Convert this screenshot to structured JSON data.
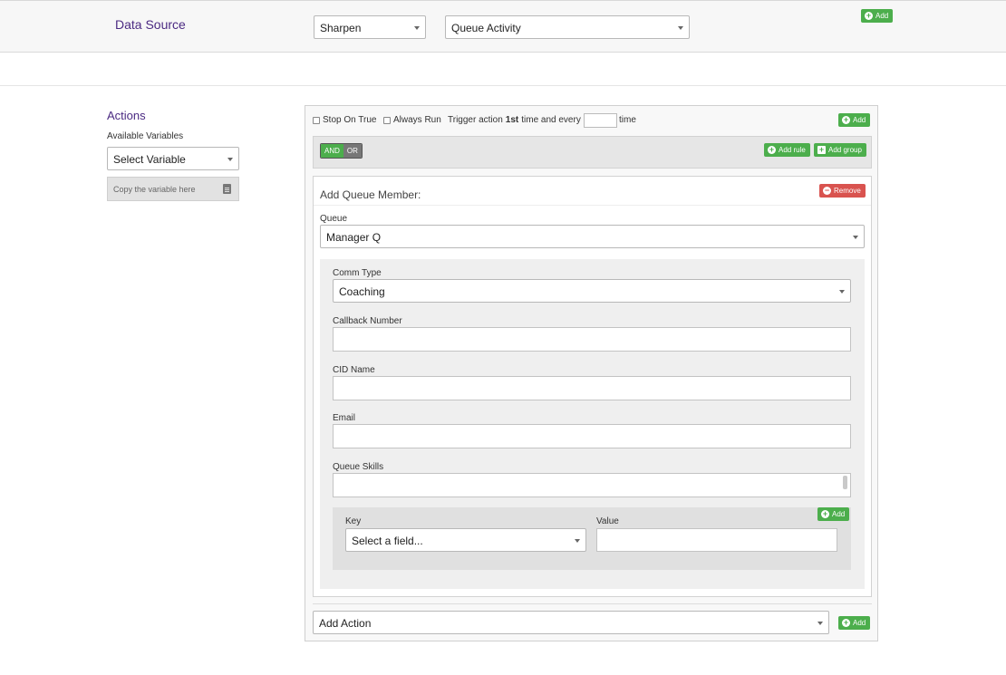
{
  "header": {
    "title": "Data Source",
    "source_select": "Sharpen",
    "type_select": "Queue Activity",
    "add_label": "Add"
  },
  "sidebar": {
    "title": "Actions",
    "variables_label": "Available Variables",
    "variable_select": "Select Variable",
    "copy_hint": "Copy the variable here"
  },
  "trigger": {
    "stop_on_true": "Stop On True",
    "always_run": "Always Run",
    "trigger_prefix": "Trigger action",
    "trigger_count": "1st",
    "trigger_suffix": "time and every",
    "time_label": "time",
    "add_label": "Add"
  },
  "rules": {
    "and_label": "AND",
    "or_label": "OR",
    "add_rule": "Add rule",
    "add_group": "Add group"
  },
  "member": {
    "title": "Add Queue Member:",
    "remove_label": "Remove",
    "queue_label": "Queue",
    "queue_value": "Manager Q",
    "comm_type_label": "Comm Type",
    "comm_type_value": "Coaching",
    "callback_label": "Callback Number",
    "cid_label": "CID Name",
    "email_label": "Email",
    "skills_label": "Queue Skills",
    "key_label": "Key",
    "key_placeholder": "Select a field...",
    "value_label": "Value",
    "kv_add_label": "Add"
  },
  "footer": {
    "action_select": "Add Action",
    "add_label": "Add"
  },
  "colors": {
    "brand": "#4b2a82",
    "success": "#4cae4c",
    "danger": "#d9534f"
  }
}
